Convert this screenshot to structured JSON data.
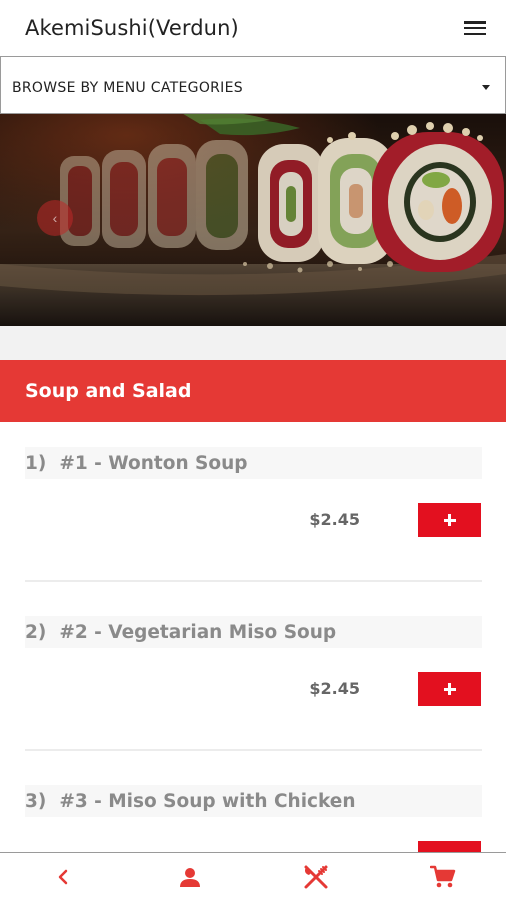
{
  "header": {
    "app_title": "AkemiSushi(Verdun)",
    "menu_icon": "hamburger-menu-icon"
  },
  "category_select": {
    "label": "BROWSE BY MENU CATEGORIES",
    "icon": "caret-down-icon"
  },
  "hero": {
    "prev_icon": "chevron-left-icon",
    "prev_glyph": "‹"
  },
  "section": {
    "title": "Soup and Salad"
  },
  "menu_items": [
    {
      "number": "1)",
      "name": "#1 - Wonton Soup",
      "price": "$2.45"
    },
    {
      "number": "2)",
      "name": "#2 - Vegetarian Miso Soup",
      "price": "$2.45"
    },
    {
      "number": "3)",
      "name": "#3 - Miso Soup with Chicken",
      "price": ""
    }
  ],
  "bottom_nav": [
    {
      "name": "back",
      "icon": "chevron-left-icon"
    },
    {
      "name": "account",
      "icon": "user-icon"
    },
    {
      "name": "menu",
      "icon": "utensils-icon"
    },
    {
      "name": "cart",
      "icon": "cart-icon"
    }
  ],
  "colors": {
    "accent": "#e53935",
    "button": "#e3101f",
    "text_dark": "#222222",
    "item_text": "#8a8a8a"
  }
}
